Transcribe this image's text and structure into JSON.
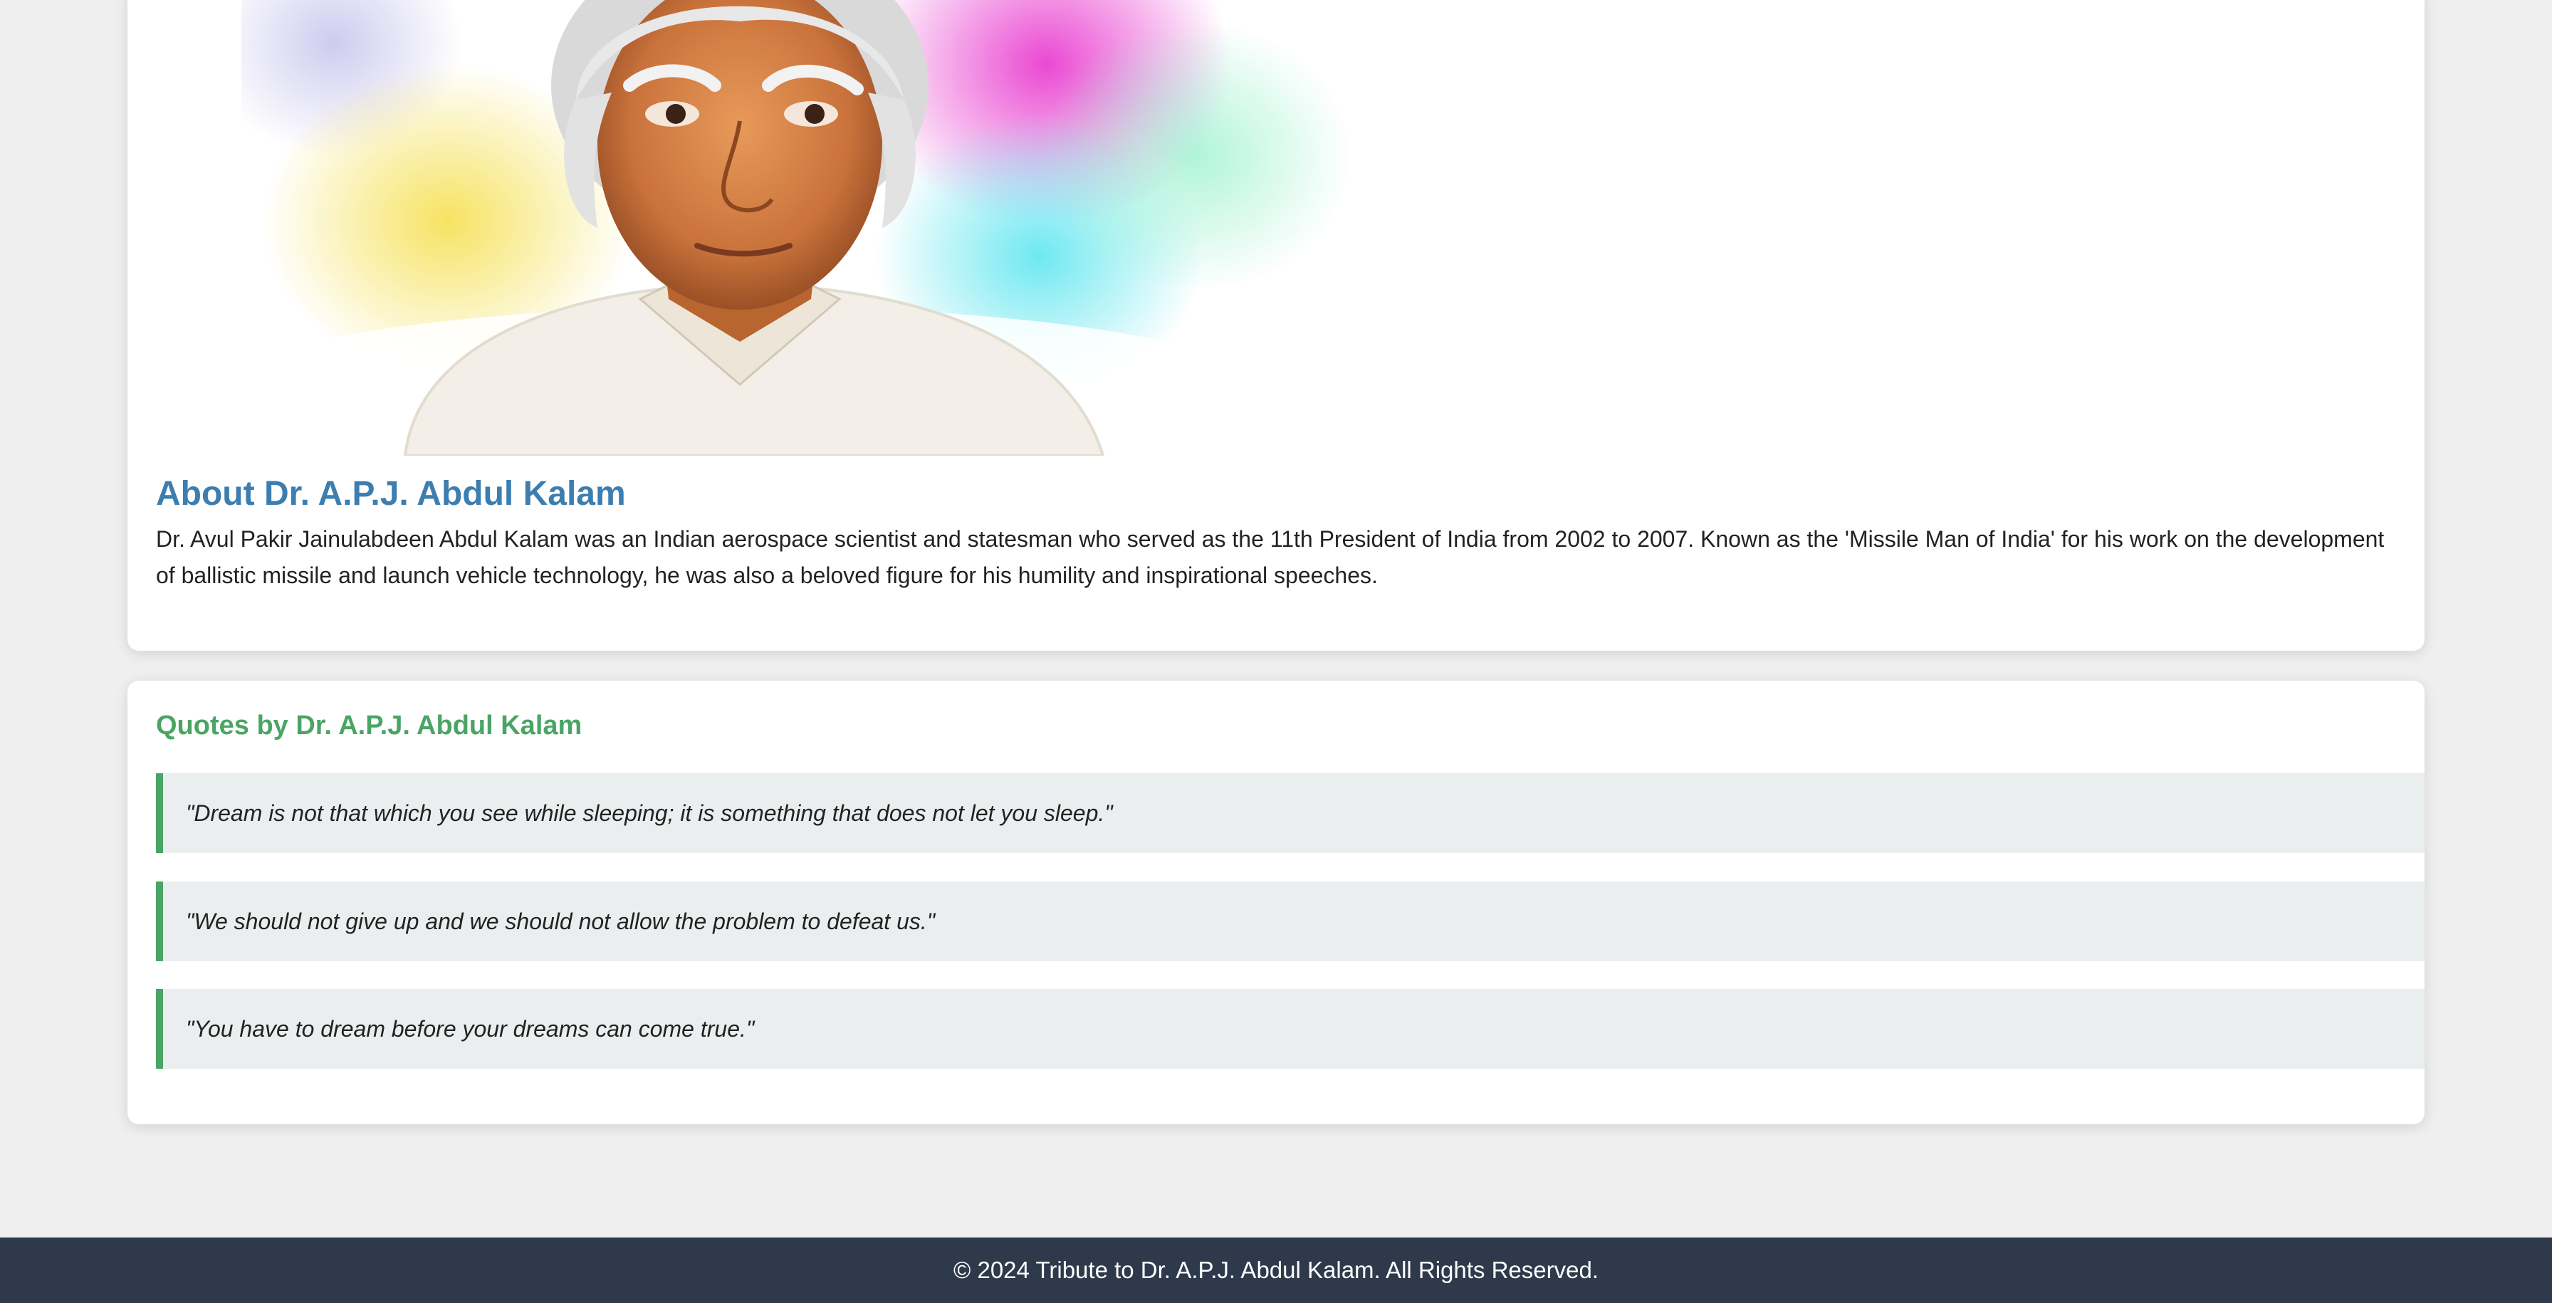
{
  "about": {
    "title": "About Dr. A.P.J. Abdul Kalam",
    "text": "Dr. Avul Pakir Jainulabdeen Abdul Kalam was an Indian aerospace scientist and statesman who served as the 11th President of India from 2002 to 2007. Known as the 'Missile Man of India' for his work on the development of ballistic missile and launch vehicle technology, he was also a beloved figure for his humility and inspirational speeches."
  },
  "quotes": {
    "title": "Quotes by Dr. A.P.J. Abdul Kalam",
    "items": [
      "\"Dream is not that which you see while sleeping; it is something that does not let you sleep.\"",
      "\"We should not give up and we should not allow the problem to defeat us.\"",
      "\"You have to dream before your dreams can come true.\""
    ]
  },
  "footer": {
    "text": "© 2024 Tribute to Dr. A.P.J. Abdul Kalam. All Rights Reserved."
  },
  "colors": {
    "about_heading": "#3d7eb0",
    "quotes_accent": "#4aa565",
    "footer_bg": "#2e3a4b"
  }
}
